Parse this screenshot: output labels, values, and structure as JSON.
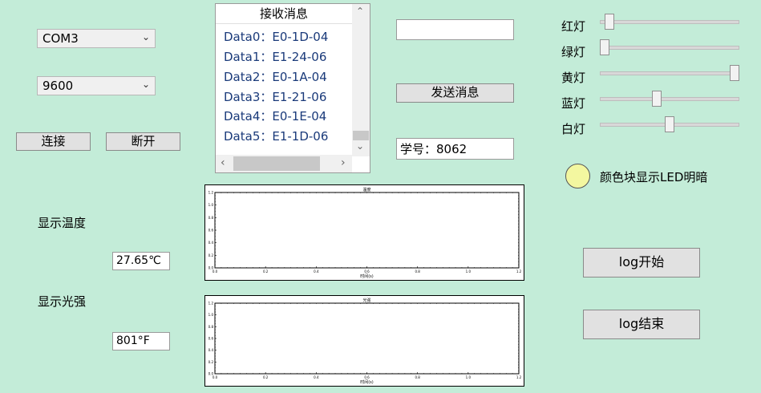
{
  "serial": {
    "port_value": "COM3",
    "baud_value": "9600",
    "connect_label": "连接",
    "disconnect_label": "断开"
  },
  "receive": {
    "header": "接收消息",
    "rows": [
      "Data0：E0-1D-04",
      "Data1：E1-24-06",
      "Data2：E0-1A-04",
      "Data3：E1-21-06",
      "Data4：E0-1E-04",
      "Data5：E1-1D-06"
    ]
  },
  "send": {
    "input_value": "",
    "button_label": "发送消息",
    "student_id": "学号：8062"
  },
  "lights": {
    "items": [
      {
        "label": "红灯",
        "level": 0.04
      },
      {
        "label": "绿灯",
        "level": 0.0
      },
      {
        "label": "黄灯",
        "level": 1.0
      },
      {
        "label": "蓝灯",
        "level": 0.4
      },
      {
        "label": "白灯",
        "level": 0.5
      }
    ],
    "indicator_label": "颜色块显示LED明暗",
    "indicator_color": "#f3f7a0"
  },
  "sensors": {
    "temp_label": "显示温度",
    "temp_value": "27.65℃",
    "light_label": "显示光强",
    "light_value": "801°F"
  },
  "log": {
    "start_label": "log开始",
    "stop_label": "log结束"
  },
  "chart_data": [
    {
      "type": "line",
      "title": "温度",
      "xlabel": "时间(s)",
      "ylabel": "",
      "x_ticks": [
        "0.0",
        "0.2",
        "0.4",
        "0.6",
        "0.8",
        "1.0",
        "1.2"
      ],
      "y_ticks": [
        "0.0",
        "0.2",
        "0.4",
        "0.6",
        "0.8",
        "1.0",
        "1.2"
      ],
      "xlim": [
        0,
        1.2
      ],
      "ylim": [
        0,
        1.2
      ],
      "series": []
    },
    {
      "type": "line",
      "title": "光强",
      "xlabel": "时间(s)",
      "ylabel": "",
      "x_ticks": [
        "0.0",
        "0.2",
        "0.4",
        "0.6",
        "0.8",
        "1.0",
        "1.2"
      ],
      "y_ticks": [
        "0.0",
        "0.2",
        "0.4",
        "0.6",
        "0.8",
        "1.0",
        "1.2"
      ],
      "xlim": [
        0,
        1.2
      ],
      "ylim": [
        0,
        1.2
      ],
      "series": []
    }
  ]
}
